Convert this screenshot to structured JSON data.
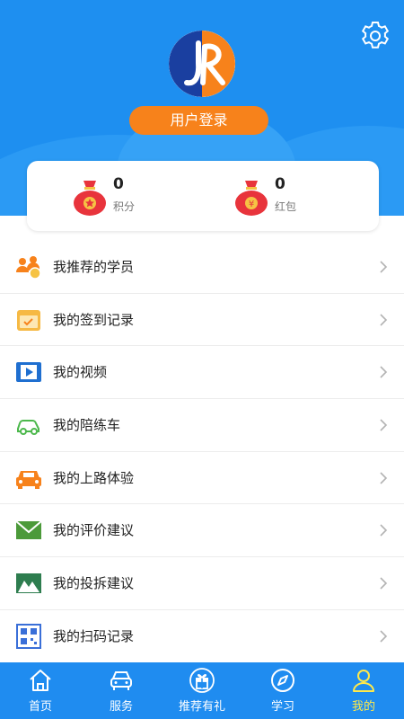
{
  "header": {
    "login_label": "用户登录"
  },
  "stats": [
    {
      "value": "0",
      "label": "积分"
    },
    {
      "value": "0",
      "label": "红包"
    }
  ],
  "menu": [
    {
      "label": "我推荐的学员",
      "icon": "users-icon"
    },
    {
      "label": "我的签到记录",
      "icon": "calendar-icon"
    },
    {
      "label": "我的视频",
      "icon": "video-icon"
    },
    {
      "label": "我的陪练车",
      "icon": "car-outline-icon"
    },
    {
      "label": "我的上路体验",
      "icon": "car-icon"
    },
    {
      "label": "我的评价建议",
      "icon": "mail-icon"
    },
    {
      "label": "我的投拆建议",
      "icon": "mountain-icon"
    },
    {
      "label": "我的扫码记录",
      "icon": "qr-code-icon"
    }
  ],
  "tabs": [
    {
      "label": "首页",
      "icon": "home-icon"
    },
    {
      "label": "服务",
      "icon": "car-front-icon"
    },
    {
      "label": "推荐有礼",
      "icon": "gift-icon"
    },
    {
      "label": "学习",
      "icon": "compass-icon"
    },
    {
      "label": "我的",
      "icon": "user-icon",
      "active": true
    }
  ],
  "colors": {
    "primary": "#1e8ff0",
    "accent": "#f7821b",
    "active_tab": "#ffe94a"
  }
}
